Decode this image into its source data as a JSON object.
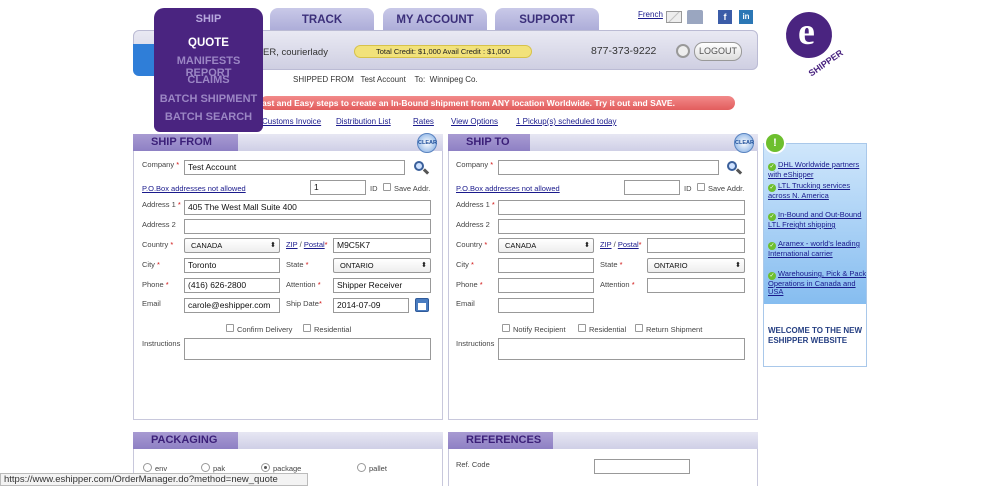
{
  "nav": {
    "tabs": [
      "SHIP",
      "TRACK",
      "MY ACCOUNT",
      "SUPPORT"
    ],
    "ship_menu": [
      "QUOTE",
      "MANIFESTS REPORT",
      "CLAIMS",
      "BATCH SHIPMENT",
      "BATCH SEARCH"
    ],
    "language_link": "French"
  },
  "header": {
    "user_text": "ER, courierlady",
    "credit_text": "Total Credit: $1,000  Avail Credit : $1,000",
    "phone": "877-373-9222",
    "logout_label": "LOGOUT",
    "shipped_from_label": "SHIPPED FROM",
    "shipped_from_value": "Test Account",
    "to_label": "To:",
    "to_value": "Winnipeg Co.",
    "banner_text": "ast and Easy steps to create an In-Bound shipment from ANY location Worldwide. Try it out and SAVE.",
    "links": [
      "Customs Invoice",
      "Distribution List",
      "Rates",
      "View Options",
      "1 Pickup(s) scheduled today"
    ]
  },
  "logo": {
    "text": "SHIPPER",
    "letter": "e"
  },
  "ship_from": {
    "title": "SHIP FROM",
    "clear_label": "CLEAR",
    "company_label": "Company",
    "company_value": "Test Account",
    "pobox_text": "P.O.Box addresses not allowed",
    "id_value": "1",
    "id_label": "ID",
    "save_addr_label": "Save Addr.",
    "address1_label": "Address 1",
    "address1_value": "405 The West Mall Suite 400",
    "address2_label": "Address 2",
    "address2_value": "",
    "country_label": "Country",
    "country_value": "CANADA",
    "zip_label_a": "ZIP",
    "zip_label_b": "Postal",
    "zip_value": "M9C5K7",
    "city_label": "City",
    "city_value": "Toronto",
    "state_label": "State",
    "state_value": "ONTARIO",
    "phone_label": "Phone",
    "phone_value": "(416) 626-2800",
    "attention_label": "Attention",
    "attention_value": "Shipper Receiver",
    "email_label": "Email",
    "email_value": "carole@eshipper.com",
    "shipdate_label": "Ship Date",
    "shipdate_value": "2014-07-09",
    "confirm_delivery_label": "Confirm Delivery",
    "residential_label": "Residential",
    "instructions_label": "Instructions",
    "instructions_value": ""
  },
  "ship_to": {
    "title": "SHIP TO",
    "clear_label": "CLEAR",
    "company_label": "Company",
    "company_value": "",
    "pobox_text": "P.O.Box addresses not allowed",
    "id_value": "",
    "id_label": "ID",
    "save_addr_label": "Save Addr.",
    "address1_label": "Address 1",
    "address1_value": "",
    "address2_label": "Address 2",
    "address2_value": "",
    "country_label": "Country",
    "country_value": "CANADA",
    "zip_label_a": "ZIP",
    "zip_label_b": "Postal",
    "zip_value": "",
    "city_label": "City",
    "city_value": "",
    "state_label": "State",
    "state_value": "ONTARIO",
    "phone_label": "Phone",
    "phone_value": "",
    "attention_label": "Attention",
    "attention_value": "",
    "email_label": "Email",
    "email_value": "",
    "notify_label": "Notify Recipient",
    "residential_label": "Residential",
    "return_label": "Return Shipment",
    "instructions_label": "Instructions",
    "instructions_value": ""
  },
  "sidebar": {
    "items": [
      "DHL Worldwide partners with eShipper",
      "LTL Trucking services across N. America",
      "In-Bound and Out-Bound LTL Freight shipping",
      "Aramex - world's leading International carrier",
      "Warehousing, Pick & Pack Operations in Canada and USA"
    ],
    "welcome": "WELCOME TO THE NEW ESHIPPER WEBSITE"
  },
  "packaging": {
    "title": "PACKAGING",
    "options": [
      "env",
      "pak",
      "package",
      "pallet"
    ],
    "selected": "package"
  },
  "references": {
    "title": "REFERENCES",
    "ref_code_label": "Ref. Code",
    "ref_code_value": ""
  },
  "status_bar": {
    "url": "https://www.eshipper.com/OrderManager.do?method=new_quote"
  }
}
